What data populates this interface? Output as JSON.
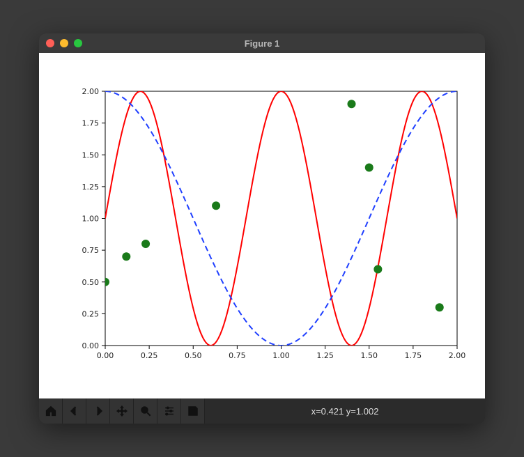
{
  "window": {
    "title": "Figure 1",
    "traffic_colors": {
      "close": "#ff5f57",
      "minimize": "#febc2e",
      "zoom": "#28c840"
    }
  },
  "toolbar": {
    "buttons": [
      {
        "name": "home-icon",
        "label": "Home"
      },
      {
        "name": "back-icon",
        "label": "Back"
      },
      {
        "name": "forward-icon",
        "label": "Forward"
      },
      {
        "name": "pan-icon",
        "label": "Pan"
      },
      {
        "name": "zoom-icon",
        "label": "Zoom"
      },
      {
        "name": "configure-icon",
        "label": "Configure subplots"
      },
      {
        "name": "save-icon",
        "label": "Save"
      }
    ],
    "coord_readout": "x=0.421 y=1.002"
  },
  "chart_data": {
    "type": "line",
    "title": "",
    "xlabel": "",
    "ylabel": "",
    "xlim": [
      0.0,
      2.0
    ],
    "ylim": [
      0.0,
      2.0
    ],
    "xticks": [
      "0.00",
      "0.25",
      "0.50",
      "0.75",
      "1.00",
      "1.25",
      "1.50",
      "1.75",
      "2.00"
    ],
    "yticks": [
      "0.00",
      "0.25",
      "0.50",
      "0.75",
      "1.00",
      "1.25",
      "1.50",
      "1.75",
      "2.00"
    ],
    "grid": false,
    "series": [
      {
        "name": "red-solid",
        "type": "line",
        "style": "solid",
        "color": "#ff0000",
        "expr": "y = 1 + sin(2*pi*x / 0.8)",
        "x_range": [
          0.0,
          2.0
        ],
        "n_points": 200
      },
      {
        "name": "blue-dashed",
        "type": "line",
        "style": "dashed",
        "color": "#1f3fff",
        "expr": "y = 1 + cos(pi*x)",
        "x_range": [
          0.0,
          2.0
        ],
        "n_points": 200
      },
      {
        "name": "green-dots",
        "type": "scatter",
        "color": "#1a7a1a",
        "x": [
          0.0,
          0.12,
          0.23,
          0.63,
          1.4,
          1.5,
          1.55,
          1.9
        ],
        "y": [
          0.5,
          0.7,
          0.8,
          1.1,
          1.9,
          1.4,
          0.6,
          0.3
        ]
      }
    ]
  }
}
